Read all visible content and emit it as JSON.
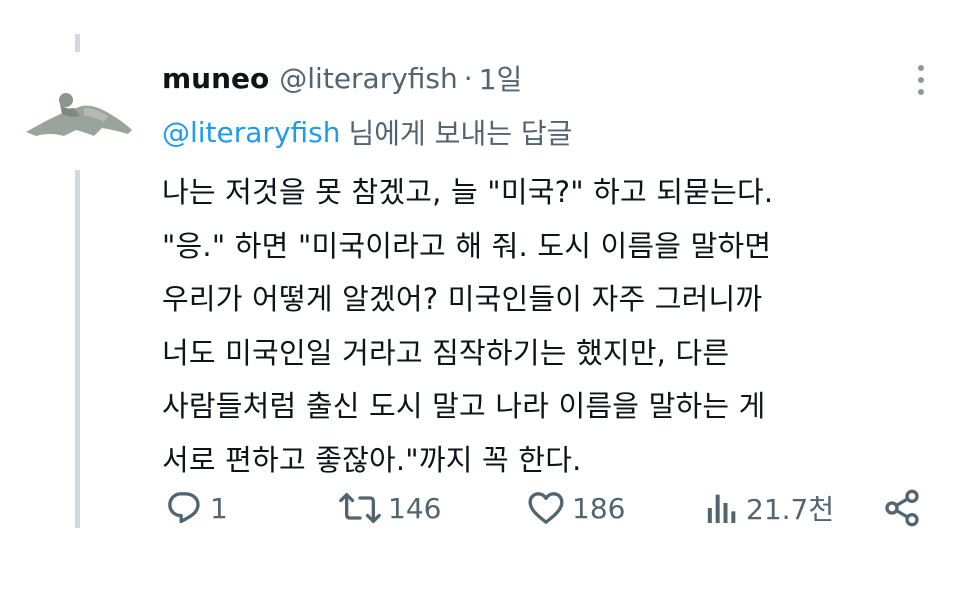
{
  "tweet": {
    "author_name": "muneo",
    "author_handle": "@literaryfish",
    "separator": "·",
    "timestamp": "1일",
    "reply_to_mention": "@literaryfish",
    "reply_to_text": "님에게 보내는 답글",
    "body_lines": [
      "나는 저것을 못 참겠고, 늘 \"미국?\" 하고 되묻는다.",
      "\"응.\" 하면 \"미국이라고 해 줘. 도시 이름을 말하면",
      "우리가 어떻게 알겠어? 미국인들이 자주 그러니까",
      "너도 미국인일 거라고 짐작하기는 했지만, 다른",
      "사람들처럼 출신 도시 말고 나라 이름을 말하는 게",
      "서로 편하고 좋잖아.\"까지 꼭 한다."
    ]
  },
  "actions": {
    "replies": "1",
    "retweets": "146",
    "likes": "186",
    "views": "21.7천"
  },
  "icons": {
    "reply": "reply-icon",
    "retweet": "retweet-icon",
    "like": "heart-icon",
    "views": "views-icon",
    "share": "share-icon",
    "more": "more-icon"
  },
  "colors": {
    "text": "#0f1419",
    "secondary": "#536471",
    "accent": "#1d9bf0",
    "thread_line": "#cfd9de"
  }
}
